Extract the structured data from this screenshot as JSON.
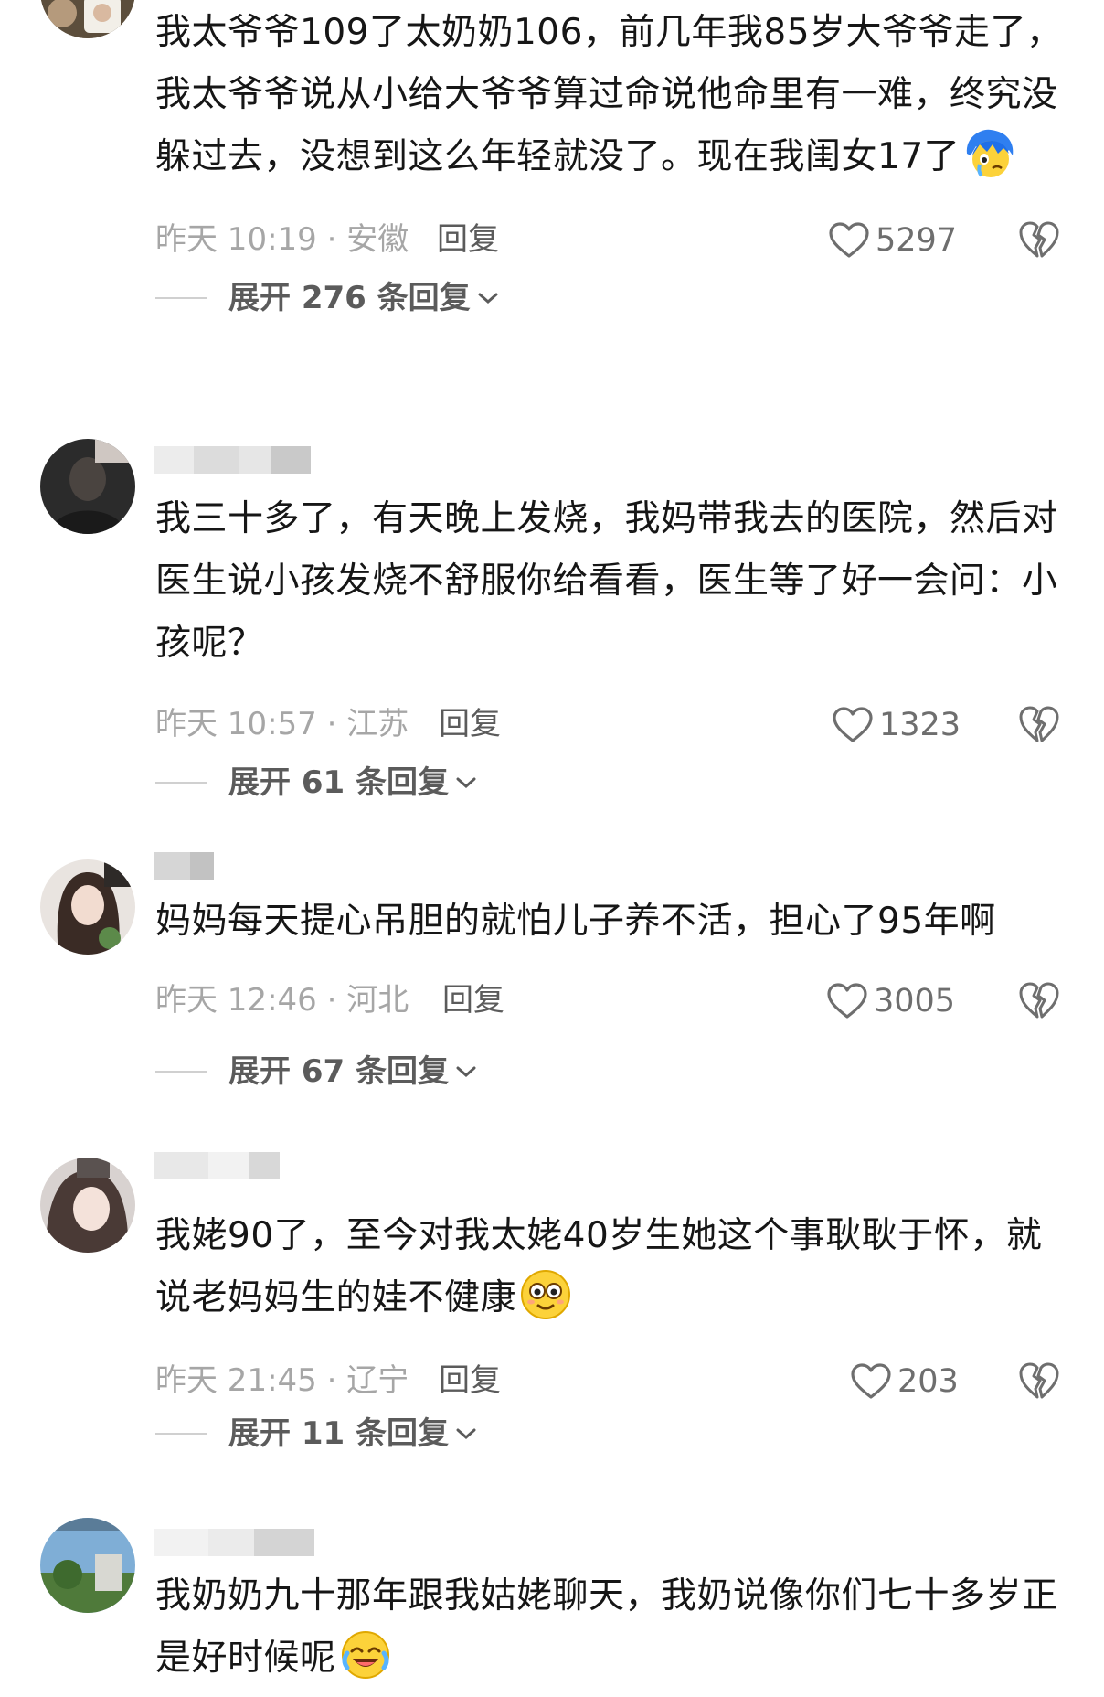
{
  "comments": [
    {
      "text": "我太爷爷109了太奶奶106，前几年我85岁大爷爷走了，我太爷爷说从小给大爷爷算过命说他命里有一难，终究没躲过去，没想到这么年轻就没了。现在我闺女17了",
      "emoji": "crying-face-blue-hair-emoji",
      "time_location": "昨天 10:19 · 安徽",
      "reply_label": "回复",
      "likes": "5297",
      "expand_label": "展开 276 条回复"
    },
    {
      "text": "我三十多了，有天晚上发烧，我妈带我去的医院，然后对医生说小孩发烧不舒服你给看看，医生等了好一会问：小孩呢？",
      "emoji": "",
      "time_location": "昨天 10:57 · 江苏",
      "reply_label": "回复",
      "likes": "1323",
      "expand_label": "展开 61 条回复"
    },
    {
      "text": "妈妈每天提心吊胆的就怕儿子养不活，担心了95年啊",
      "emoji": "",
      "time_location": "昨天 12:46 · 河北",
      "reply_label": "回复",
      "likes": "3005",
      "expand_label": "展开 67 条回复"
    },
    {
      "text": "我姥90了，至今对我太姥40岁生她这个事耿耿于怀，就说老妈妈生的娃不健康",
      "emoji": "staring-eyes-emoji",
      "time_location": "昨天 21:45 · 辽宁",
      "reply_label": "回复",
      "likes": "203",
      "expand_label": "展开 11 条回复"
    },
    {
      "text": "我奶奶九十那年跟我姑姥聊天，我奶说像你们七十多岁正是好时候呢",
      "emoji": "laughing-tears-emoji",
      "time_location": "",
      "reply_label": "",
      "likes": "",
      "expand_label": ""
    }
  ],
  "icons": {
    "like": "heart-outline-icon",
    "dislike": "broken-heart-icon",
    "expand": "chevron-down-icon"
  },
  "colors": {
    "text": "#161616",
    "meta": "#a6a6a6",
    "action": "#5b5b5b"
  }
}
